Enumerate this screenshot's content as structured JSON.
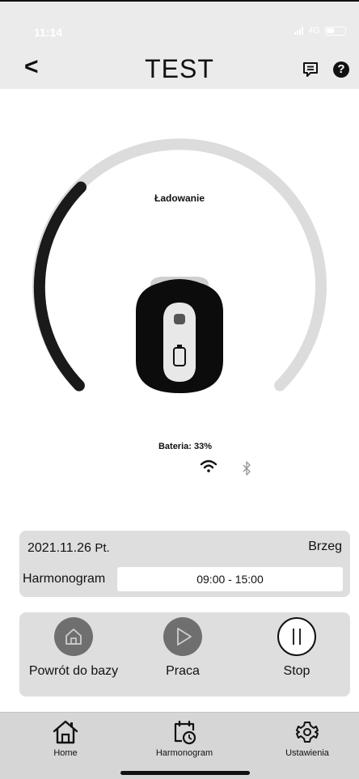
{
  "status_bar": {
    "time": "11:14",
    "network": "4G",
    "icons": [
      "signal-icon",
      "battery-status-icon"
    ]
  },
  "header": {
    "title": "TEST",
    "icons": [
      "back-chevron-icon",
      "message-icon",
      "help-icon"
    ]
  },
  "help_glyph": "?",
  "mower": {
    "status": "Ładowanie",
    "battery_label": "Bateria: 33%",
    "battery_percent": 33,
    "connectivity_icons": [
      "wifi-icon",
      "bluetooth-icon"
    ]
  },
  "info": {
    "date": "2021.11.26",
    "day": "Pt.",
    "location": "Brzeg",
    "schedule_label": "Harmonogram",
    "schedule_value": "09:00 - 15:00"
  },
  "controls": [
    {
      "label": "Powrót do bazy",
      "icon": "home-icon"
    },
    {
      "label": "Praca",
      "icon": "play-icon"
    },
    {
      "label": "Stop",
      "icon": "pause-icon"
    }
  ],
  "tabs": [
    {
      "label": "Home",
      "icon": "home-tab-icon"
    },
    {
      "label": "Harmonogram",
      "icon": "calendar-clock-icon"
    },
    {
      "label": "Ustawienia",
      "icon": "gear-icon"
    }
  ],
  "colors": {
    "bar_background": "#ebebeb",
    "card_background": "#dedede",
    "gauge_track": "#dcdcdc",
    "gauge_fill": "#1a1a1a",
    "tabbar_background": "#d6d6d6"
  }
}
